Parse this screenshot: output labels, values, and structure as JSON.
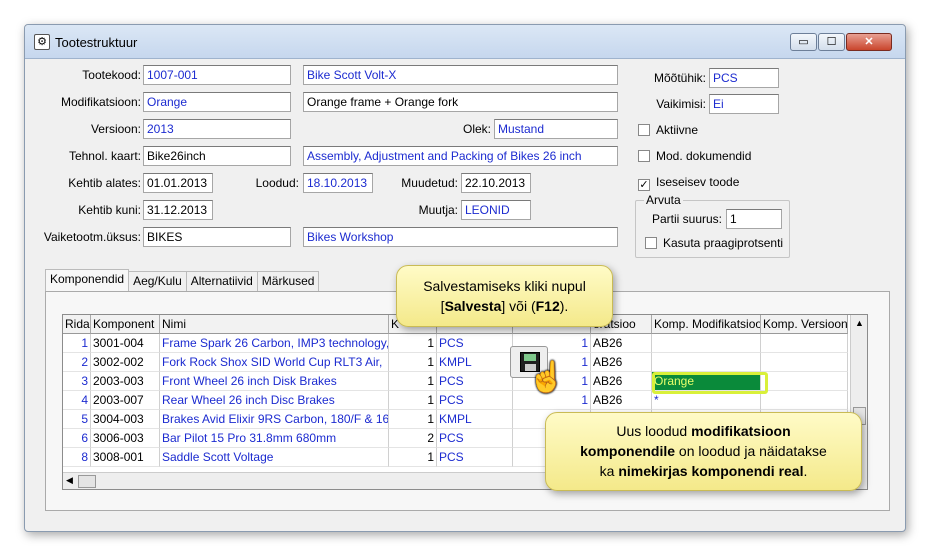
{
  "window": {
    "title": "Tootestruktuur",
    "icon": "gear-icon",
    "min": "▭",
    "max": "☐",
    "close": "✕"
  },
  "form": {
    "tootekood": {
      "label": "Tootekood:",
      "value": "1007-001",
      "desc": "Bike Scott Volt-X"
    },
    "modifikatsioon": {
      "label": "Modifikatsioon:",
      "value": "Orange",
      "desc": "Orange frame + Orange fork"
    },
    "versioon": {
      "label": "Versioon:",
      "value": "2013"
    },
    "olek": {
      "label": "Olek:",
      "value": "Mustand"
    },
    "tehnol_kaart": {
      "label": "Tehnol. kaart:",
      "value": "Bike26inch",
      "desc": "Assembly, Adjustment and Packing of Bikes 26 inch"
    },
    "kehtib_alates": {
      "label": "Kehtib alates:",
      "value": "01.01.2013"
    },
    "loodud": {
      "label": "Loodud:",
      "value": "18.10.2013"
    },
    "muudetud": {
      "label": "Muudetud:",
      "value": "22.10.2013"
    },
    "kehtib_kuni": {
      "label": "Kehtib kuni:",
      "value": "31.12.2013"
    },
    "muutja": {
      "label": "Muutja:",
      "value": "LEONID"
    },
    "vaiketootm": {
      "label": "Vaiketootm.üksus:",
      "value": "BIKES",
      "desc": "Bikes Workshop"
    },
    "mootuhik": {
      "label": "Mõõtühik:",
      "value": "PCS"
    },
    "vaikimisi": {
      "label": "Vaikimisi:",
      "value": "Ei"
    },
    "aktiivne": {
      "label": "Aktiivne",
      "checked": false
    },
    "mod_dokumendid": {
      "label": "Mod. dokumendid",
      "checked": false
    },
    "iseseisev_toode": {
      "label": "Iseseisev toode",
      "checked": true,
      "mark": "✓"
    },
    "arvuta": {
      "title": "Arvuta",
      "partii_label": "Partii suurus:",
      "partii_value": "1",
      "kasuta_label": "Kasuta praagiprotsenti",
      "kasuta_checked": false
    }
  },
  "tabs": [
    "Komponendid",
    "Aeg/Kulu",
    "Alternatiivid",
    "Märkused"
  ],
  "grid": {
    "headers": [
      "Rida",
      "Komponent",
      "Nimi",
      "K",
      "",
      "",
      "eratsioo",
      "Komp. Modifikatsioon",
      "Komp. Versioon"
    ],
    "rows": [
      {
        "rida": "1",
        "komponent": "3001-004",
        "nimi": "Frame Spark 26 Carbon, IMP3 technology,",
        "kogus": "1",
        "uhik": "PCS",
        "rida2": "1",
        "operatsioon": "AB26",
        "mod": "",
        "ver": ""
      },
      {
        "rida": "2",
        "komponent": "3002-002",
        "nimi": "Fork Rock Shox SID World Cup RLT3 Air,",
        "kogus": "1",
        "uhik": "KMPL",
        "rida2": "1",
        "operatsioon": "AB26",
        "mod": "",
        "ver": ""
      },
      {
        "rida": "3",
        "komponent": "2003-003",
        "nimi": "Front Wheel 26 inch Disk Brakes",
        "kogus": "1",
        "uhik": "PCS",
        "rida2": "1",
        "operatsioon": "AB26",
        "mod": "Orange",
        "ver": ""
      },
      {
        "rida": "4",
        "komponent": "2003-007",
        "nimi": "Rear Wheel 26 inch Disc Brakes",
        "kogus": "1",
        "uhik": "PCS",
        "rida2": "1",
        "operatsioon": "AB26",
        "mod": "*",
        "ver": ""
      },
      {
        "rida": "5",
        "komponent": "3004-003",
        "nimi": "Brakes Avid Elixir 9RS Carbon, 180/F & 16",
        "kogus": "1",
        "uhik": "KMPL",
        "rida2": "",
        "operatsioon": "",
        "mod": "",
        "ver": ""
      },
      {
        "rida": "6",
        "komponent": "3006-003",
        "nimi": "Bar Pilot 15 Pro 31.8mm 680mm",
        "kogus": "2",
        "uhik": "PCS",
        "rida2": "",
        "operatsioon": "",
        "mod": "",
        "ver": ""
      },
      {
        "rida": "8",
        "komponent": "3008-001",
        "nimi": "Saddle Scott Voltage",
        "kogus": "1",
        "uhik": "PCS",
        "rida2": "",
        "operatsioon": "",
        "mod": "",
        "ver": ""
      }
    ]
  },
  "callout1": {
    "line1": "Salvestamiseks kliki nupul",
    "pre": "[",
    "bold1": "Salvesta",
    "mid": "] või (",
    "bold2": "F12",
    "post": ")."
  },
  "callout2": {
    "l1a": "Uus loodud ",
    "l1b": "modifikatsioon",
    "l2a": "komponendile",
    "l2b": " on loodud ja näidatakse",
    "l3a": "ka ",
    "l3b": "nimekirjas komponendi real",
    "l3c": "."
  },
  "icons": {
    "save": "save-icon",
    "hand": "hand-pointer-icon",
    "hand_glyph": "☝"
  }
}
